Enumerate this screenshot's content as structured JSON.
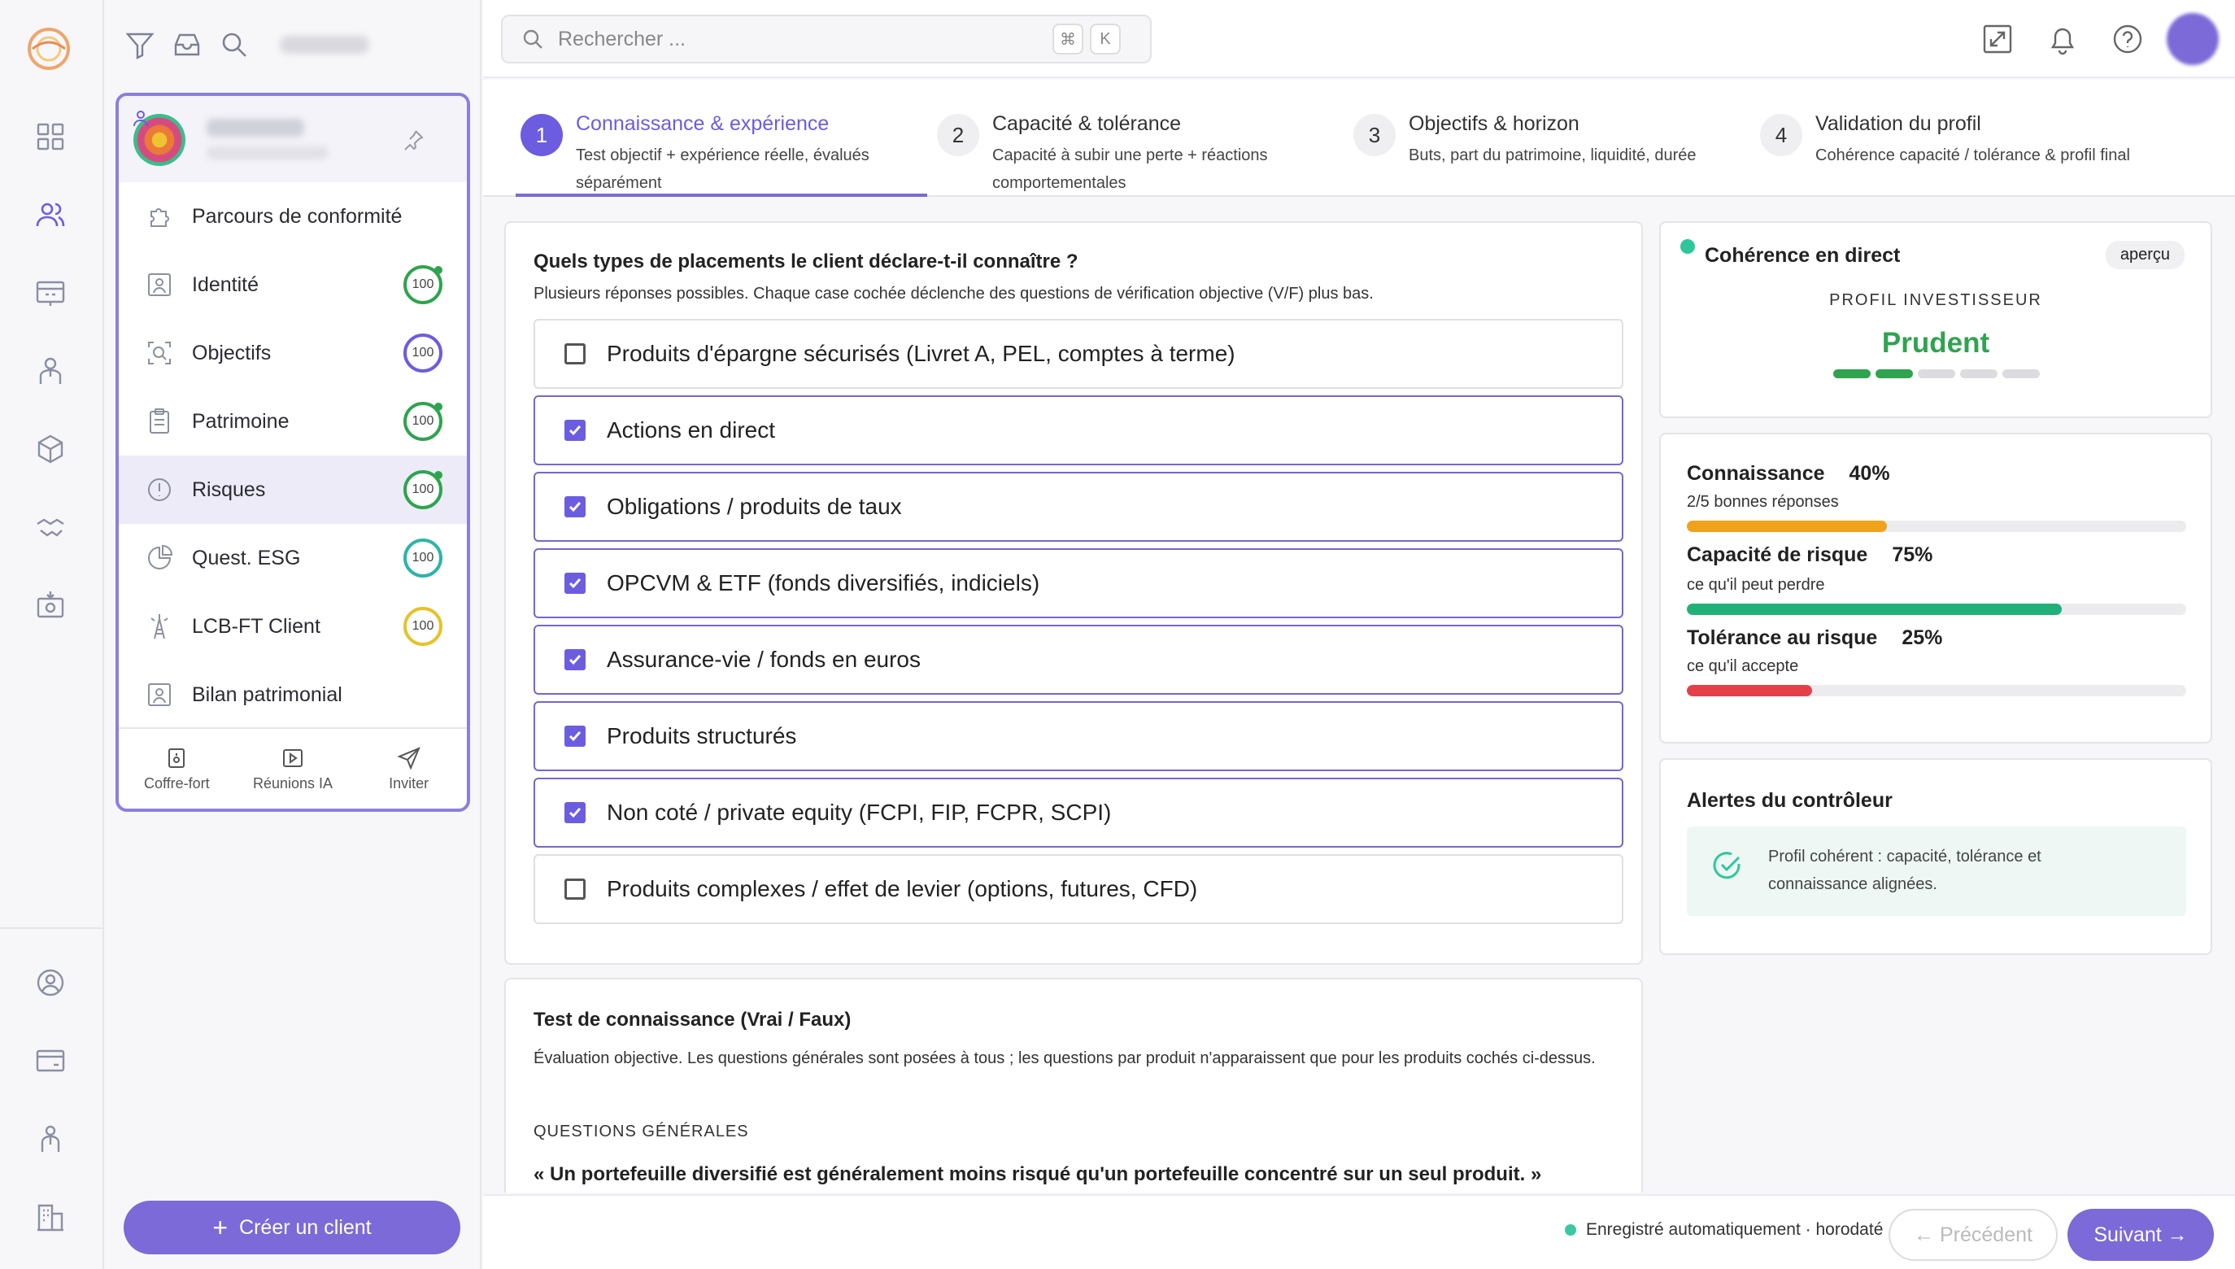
{
  "search": {
    "placeholder": "Rechercher ...",
    "kbd1": "⌘",
    "kbd2": "K"
  },
  "sidebar": {
    "items": [
      {
        "label": "Parcours de conformité",
        "icon": "puzzle-icon"
      },
      {
        "label": "Identité",
        "icon": "id-card-icon",
        "badge": "100",
        "badge_color": "#2ea44f",
        "dot": true
      },
      {
        "label": "Objectifs",
        "icon": "target-search-icon",
        "badge": "100",
        "badge_color": "#6c5ce0",
        "dot": false
      },
      {
        "label": "Patrimoine",
        "icon": "clipboard-icon",
        "badge": "100",
        "badge_color": "#2ea44f",
        "dot": true
      },
      {
        "label": "Risques",
        "icon": "alert-circle-icon",
        "badge": "100",
        "badge_color": "#2ea44f",
        "dot": true
      },
      {
        "label": "Quest. ESG",
        "icon": "pie-chart-icon",
        "badge": "100",
        "badge_color": "#2bb5a8",
        "dot": false
      },
      {
        "label": "LCB-FT Client",
        "icon": "tower-icon",
        "badge": "100",
        "badge_color": "#e6c229",
        "dot": false
      },
      {
        "label": "Bilan patrimonial",
        "icon": "portrait-icon"
      }
    ],
    "footer": {
      "vault": "Coffre-fort",
      "meetings": "Réunions IA",
      "invite": "Inviter"
    },
    "create_label": "Créer un client"
  },
  "stepper": [
    {
      "num": "1",
      "title": "Connaissance & expérience",
      "desc": "Test objectif + expérience réelle, évalués séparément"
    },
    {
      "num": "2",
      "title": "Capacité & tolérance",
      "desc": "Capacité à subir une perte + réactions comportementales"
    },
    {
      "num": "3",
      "title": "Objectifs & horizon",
      "desc": "Buts, part du patrimoine, liquidité, durée"
    },
    {
      "num": "4",
      "title": "Validation du profil",
      "desc": "Cohérence capacité / tolérance & profil final"
    }
  ],
  "question": {
    "title": "Quels types de placements le client déclare-t-il connaître ?",
    "subtitle": "Plusieurs réponses possibles. Chaque case cochée déclenche des questions de vérification objective (V/F) plus bas.",
    "options": [
      {
        "label": "Produits d'épargne sécurisés (Livret A, PEL, comptes à terme)",
        "checked": false
      },
      {
        "label": "Actions en direct",
        "checked": true
      },
      {
        "label": "Obligations / produits de taux",
        "checked": true
      },
      {
        "label": "OPCVM & ETF (fonds diversifiés, indiciels)",
        "checked": true
      },
      {
        "label": "Assurance-vie / fonds en euros",
        "checked": true
      },
      {
        "label": "Produits structurés",
        "checked": true
      },
      {
        "label": "Non coté / private equity (FCPI, FIP, FCPR, SCPI)",
        "checked": true
      },
      {
        "label": "Produits complexes / effet de levier (options, futures, CFD)",
        "checked": false
      }
    ]
  },
  "test": {
    "title": "Test de connaissance (Vrai / Faux)",
    "desc": "Évaluation objective. Les questions générales sont posées à tous ; les questions par produit n'apparaissent que pour les produits cochés ci-dessus.",
    "section": "QUESTIONS GÉNÉRALES",
    "q1": "« Un portefeuille diversifié est généralement moins risqué qu'un portefeuille concentré sur un seul produit. »"
  },
  "coherence": {
    "title": "Cohérence en direct",
    "tag": "aperçu",
    "profile_label": "PROFIL INVESTISSEUR",
    "profile_value": "Prudent",
    "profile_color": "#2ea44f",
    "level": 2,
    "level_max": 5
  },
  "metrics": [
    {
      "label": "Connaissance",
      "value": "40%",
      "sub": "2/5 bonnes réponses",
      "pct": 40,
      "color": "#f0a21a"
    },
    {
      "label": "Capacité de risque",
      "value": "75%",
      "sub": "ce qu'il peut perdre",
      "pct": 75,
      "color": "#22b07a"
    },
    {
      "label": "Tolérance au risque",
      "value": "25%",
      "sub": "ce qu'il accepte",
      "pct": 25,
      "color": "#e5404a"
    }
  ],
  "alerts": {
    "title": "Alertes du contrôleur",
    "message": "Profil cohérent : capacité, tolérance et connaissance alignées."
  },
  "bottom": {
    "autosave": "Enregistré automatiquement · horodaté",
    "prev": "← Précédent",
    "next": "Suivant →"
  }
}
